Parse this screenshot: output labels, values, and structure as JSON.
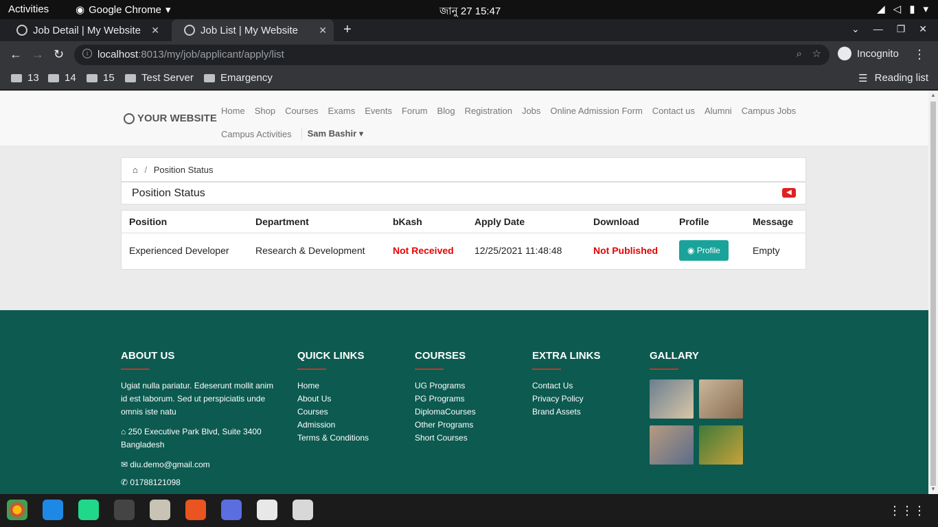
{
  "system": {
    "activities": "Activities",
    "app_name": "Google Chrome",
    "clock": "জানু 27  15:47"
  },
  "browser": {
    "tabs": [
      {
        "title": "Job Detail | My Website"
      },
      {
        "title": "Job List | My Website"
      }
    ],
    "url_host": "localhost",
    "url_rest": ":8013/my/job/applicant/apply/list",
    "incognito_label": "Incognito",
    "bookmarks": [
      "13",
      "14",
      "15",
      "Test Server",
      "Emargency"
    ],
    "reading_list": "Reading list"
  },
  "site": {
    "logo": "YOUR WEBSITE",
    "menu_row1": [
      "Home",
      "Shop",
      "Courses",
      "Exams",
      "Events",
      "Forum",
      "Blog",
      "Registration",
      "Jobs",
      "Online Admission Form",
      "Contact us",
      "Alumni",
      "Campus Jobs"
    ],
    "menu_row2": [
      "Campus Activities"
    ],
    "user": "Sam Bashir"
  },
  "breadcrumb": {
    "current": "Position Status"
  },
  "section_title": "Position Status",
  "table": {
    "headers": [
      "Position",
      "Department",
      "bKash",
      "Apply Date",
      "Download",
      "Profile",
      "Message"
    ],
    "row": {
      "position": "Experienced Developer",
      "department": "Research & Development",
      "bkash": "Not Received",
      "apply_date": "12/25/2021 11:48:48",
      "download": "Not Published",
      "profile_btn": "Profile",
      "message": "Empty"
    }
  },
  "footer": {
    "about": {
      "title": "ABOUT US",
      "text": "Ugiat nulla pariatur. Edeserunt mollit anim id est laborum. Sed ut perspiciatis unde omnis iste natu",
      "address": "250 Executive Park Blvd, Suite 3400 Bangladesh",
      "email": "diu.demo@gmail.com",
      "phone": "01788121098"
    },
    "quick": {
      "title": "QUICK LINKS",
      "items": [
        "Home",
        "About Us",
        "Courses",
        "Admission",
        "Terms & Conditions"
      ]
    },
    "courses": {
      "title": "COURSES",
      "items": [
        "UG Programs",
        "PG Programs",
        "DiplomaCourses",
        "Other Programs",
        "Short Courses"
      ]
    },
    "extra": {
      "title": "EXTRA LINKS",
      "items": [
        "Contact Us",
        "Privacy Policy",
        "Brand Assets"
      ]
    },
    "gallery": {
      "title": "GALLARY"
    }
  },
  "colors": {
    "accent": "#1aa39a",
    "footer_bg": "#0c5a50",
    "status_red": "#e60000"
  }
}
